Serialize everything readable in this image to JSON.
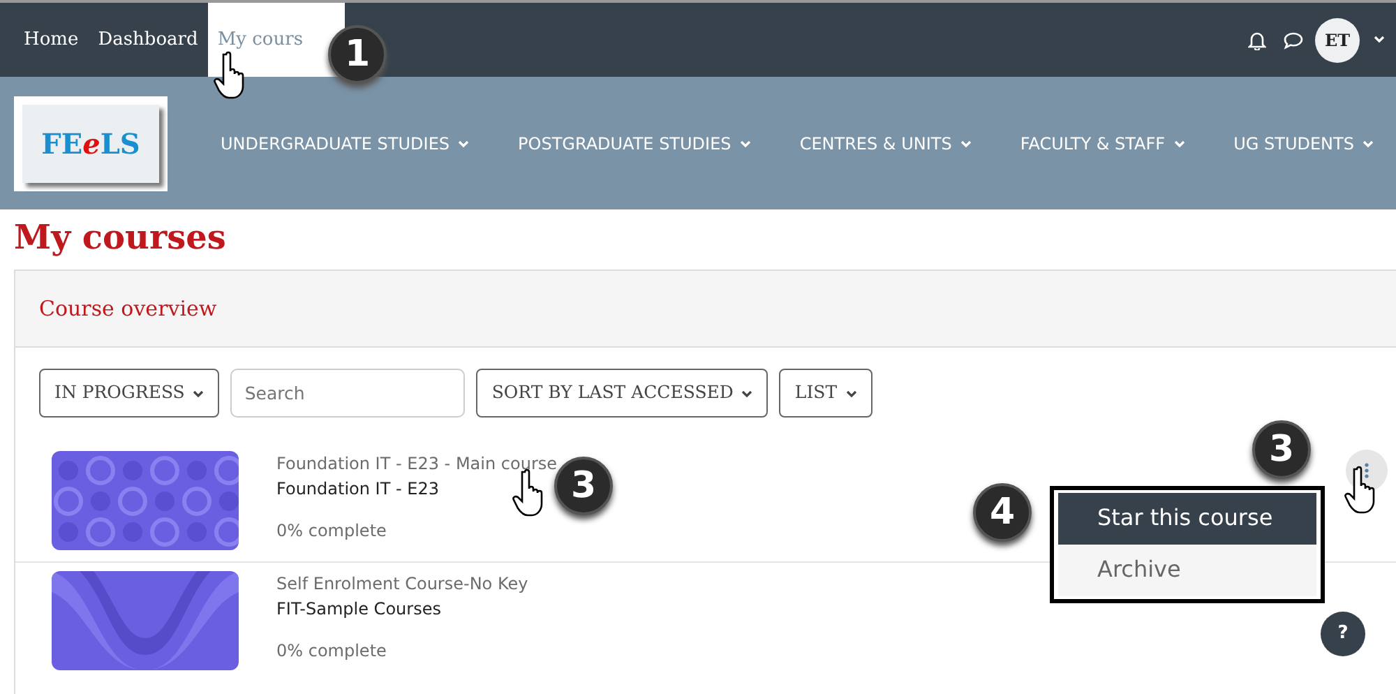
{
  "top_nav": {
    "items": [
      {
        "label": "Home",
        "selected": false
      },
      {
        "label": "Dashboard",
        "selected": false
      },
      {
        "label": "My cours",
        "selected": true,
        "callout": "1"
      }
    ],
    "avatar": "ET"
  },
  "logo": {
    "parts": [
      {
        "text": "FE",
        "accent": false
      },
      {
        "text": "e",
        "accent": true
      },
      {
        "text": "LS",
        "accent": false
      }
    ]
  },
  "help_button": "?",
  "main_menu": [
    {
      "label": "UNDERGRADUATE STUDIES"
    },
    {
      "label": "POSTGRADUATE STUDIES"
    },
    {
      "label": "CENTRES & UNITS"
    },
    {
      "label": "FACULTY & STAFF"
    },
    {
      "label": "UG STUDENTS"
    }
  ],
  "page_title": "My courses",
  "card": {
    "title": "Course overview",
    "filters": {
      "grouping": "IN PROGRESS",
      "search": {
        "placeholder": "Search"
      },
      "sort": "SORT BY LAST ACCESSED",
      "view": "LIST"
    },
    "courses": [
      {
        "category": "Foundation IT - E23 - Main course",
        "name": "Foundation IT - E23",
        "progress": "0% complete",
        "callout": "3"
      },
      {
        "category": "Self Enrolment Course-No Key",
        "name": "FIT-Sample Courses",
        "progress": "0% complete"
      }
    ],
    "actions": {
      "callout": "3",
      "menu_callout": "4",
      "menu": [
        {
          "label": "Star this course",
          "selected": true
        },
        {
          "label": "Archive",
          "selected": false
        }
      ]
    }
  }
}
